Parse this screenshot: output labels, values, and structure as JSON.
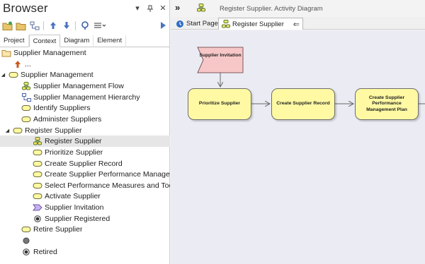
{
  "browser": {
    "title": "Browser",
    "tabs": [
      "Project",
      "Context",
      "Diagram",
      "Element"
    ],
    "active_tab": "Context"
  },
  "tree": [
    {
      "label": "Supplier Management",
      "icon": "package-icon",
      "expander": ""
    },
    {
      "label": "...",
      "icon": "up-arrow-icon",
      "expander": ""
    },
    {
      "label": "Supplier Management",
      "icon": "activity-icon",
      "expander": "open"
    },
    {
      "label": "Supplier Management Flow",
      "icon": "activity-diagram-icon",
      "expander": ""
    },
    {
      "label": "Supplier Management Hierarchy",
      "icon": "hierarchy-diagram-icon",
      "expander": ""
    },
    {
      "label": "Identify Suppliers",
      "icon": "activity-icon",
      "expander": ""
    },
    {
      "label": "Administer Suppliers",
      "icon": "activity-icon",
      "expander": ""
    },
    {
      "label": "Register Supplier",
      "icon": "activity-icon",
      "expander": "open"
    },
    {
      "label": "Register Supplier",
      "icon": "activity-diagram-icon",
      "expander": "",
      "selected": true
    },
    {
      "label": "Prioritize Supplier",
      "icon": "activity-icon",
      "expander": ""
    },
    {
      "label": "Create Supplier Record",
      "icon": "activity-icon",
      "expander": ""
    },
    {
      "label": "Create Supplier Performance Managem",
      "icon": "activity-icon",
      "expander": ""
    },
    {
      "label": "Select Performance Measures and Tool",
      "icon": "activity-icon",
      "expander": ""
    },
    {
      "label": "Activate Supplier",
      "icon": "activity-icon",
      "expander": ""
    },
    {
      "label": "Supplier Invitation",
      "icon": "event-icon",
      "expander": ""
    },
    {
      "label": "Supplier Registered",
      "icon": "final-node-icon",
      "expander": ""
    },
    {
      "label": "Retire Supplier",
      "icon": "activity-icon",
      "expander": ""
    },
    {
      "label": "",
      "icon": "initial-node-icon",
      "expander": ""
    },
    {
      "label": "Retired",
      "icon": "final-node-icon",
      "expander": ""
    }
  ],
  "diagram": {
    "collapse_glyph": "»",
    "header_title": "Register Supplier.  Activity Diagram",
    "tabs": {
      "start": "Start Page",
      "current": "Register Supplier",
      "close_glyph": "⇐"
    },
    "nodes": {
      "invitation": "Supplier Invitation",
      "prioritize": "Prioritize Supplier",
      "create_record": "Create Supplier Record",
      "create_plan": "Create Supplier Performance Management Plan"
    }
  },
  "colors": {
    "action_fill": "#fff9a3",
    "event_fill": "#f7c7c7",
    "canvas_bg": "#ebebf4",
    "selected_row": "#e6e6e6"
  }
}
